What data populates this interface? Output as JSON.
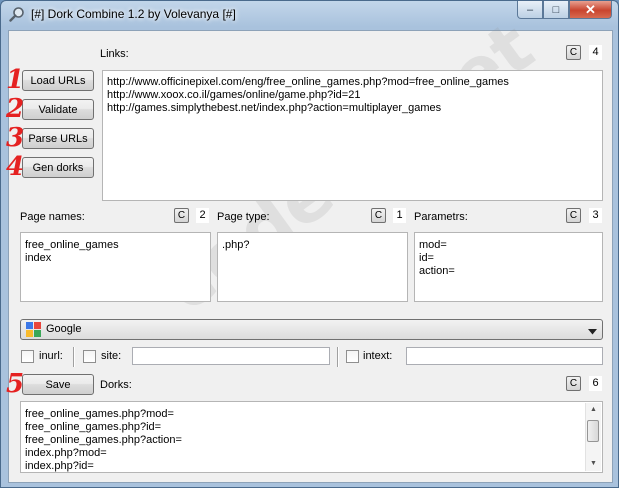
{
  "window": {
    "title": "[#] Dork Combine 1.2 by Volevanya [#]",
    "min": "–",
    "max": "□",
    "close": "✕"
  },
  "links": {
    "label": "Links:",
    "clear": "C",
    "count": "4",
    "lines": [
      "http://www.officinepixel.com/eng/free_online_games.php?mod=free_online_games",
      "http://www.xoox.co.il/games/online/game.php?id=21",
      "http://games.simplythebest.net/index.php?action=multiplayer_games"
    ]
  },
  "buttons": {
    "load": "Load URLs",
    "validate": "Validate",
    "parse": "Parse URLs",
    "gen": "Gen dorks",
    "save": "Save"
  },
  "page_names": {
    "label": "Page names:",
    "clear": "C",
    "count": "2",
    "lines": [
      "free_online_games",
      "index"
    ]
  },
  "page_type": {
    "label": "Page type:",
    "clear": "C",
    "count": "1",
    "lines": [
      ".php?"
    ]
  },
  "params": {
    "label": "Parametrs:",
    "clear": "C",
    "count": "3",
    "lines": [
      "mod=",
      "id=",
      "action="
    ]
  },
  "engine": {
    "selected": "Google"
  },
  "filters": {
    "inurl": "inurl:",
    "site": "site:",
    "intext": "intext:",
    "site_value": "",
    "intext_value": ""
  },
  "dorks": {
    "label": "Dorks:",
    "clear": "C",
    "count": "6",
    "lines": [
      "free_online_games.php?mod=",
      "free_online_games.php?id=",
      "free_online_games.php?action=",
      "index.php?mod=",
      "index.php?id="
    ]
  },
  "annotations": [
    "1",
    "2",
    "3",
    "4",
    "5"
  ],
  "watermark": "codeby.net"
}
